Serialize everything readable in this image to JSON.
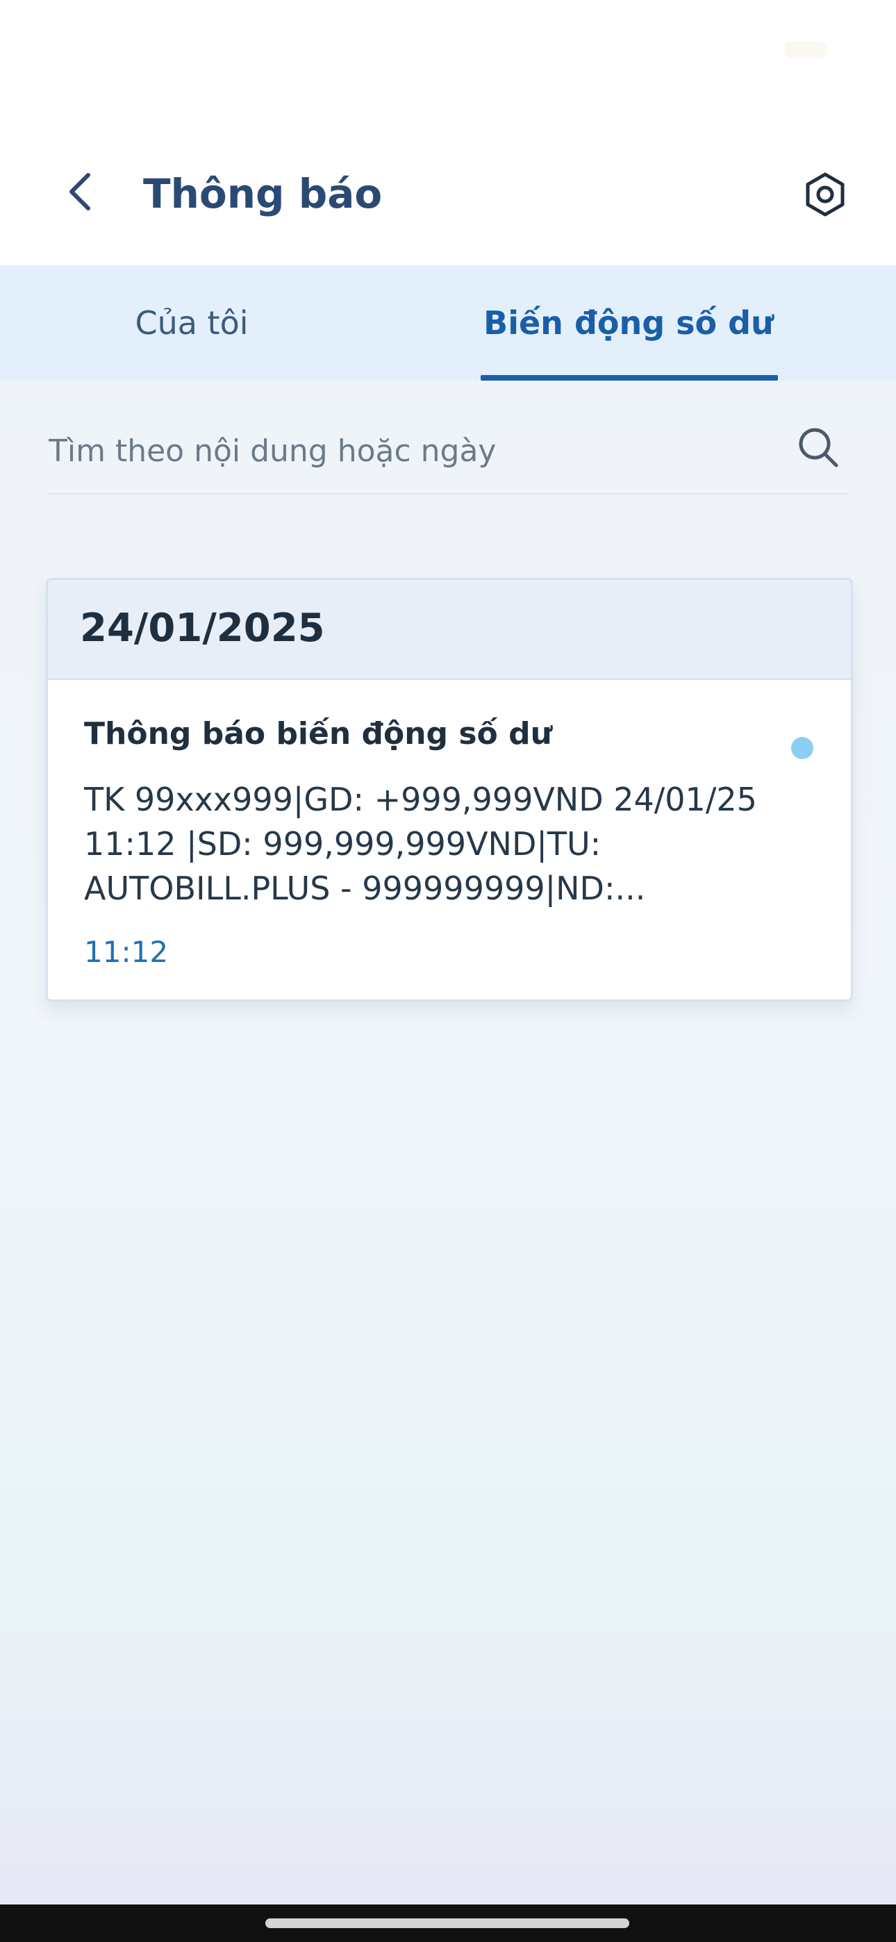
{
  "header": {
    "title": "Thông báo",
    "back_icon": "chevron-left-icon",
    "settings_icon": "gear-icon"
  },
  "tabs": [
    {
      "label": "Của tôi",
      "active": false
    },
    {
      "label": "Biến động số dư",
      "active": true
    }
  ],
  "search": {
    "placeholder": "Tìm theo nội dung hoặc ngày",
    "value": "",
    "icon": "search-icon"
  },
  "notifications": {
    "groups": [
      {
        "date": "24/01/2025",
        "items": [
          {
            "title": "Thông báo biến động số dư",
            "body": "TK 99xxx999|GD: +999,999VND 24/01/25 11:12 |SD: 999,999,999VND|TU: AUTOBILL.PLUS - 999999999|ND:...",
            "time": "11:12",
            "unread": true
          }
        ]
      }
    ]
  },
  "colors": {
    "title": "#2b4a73",
    "active_tab": "#1a5ea8",
    "tab_bar_bg": "#e3effb",
    "date_header_bg": "#e7eef8",
    "unread_dot": "#8dcdf4",
    "time_text": "#1f6fb5"
  }
}
